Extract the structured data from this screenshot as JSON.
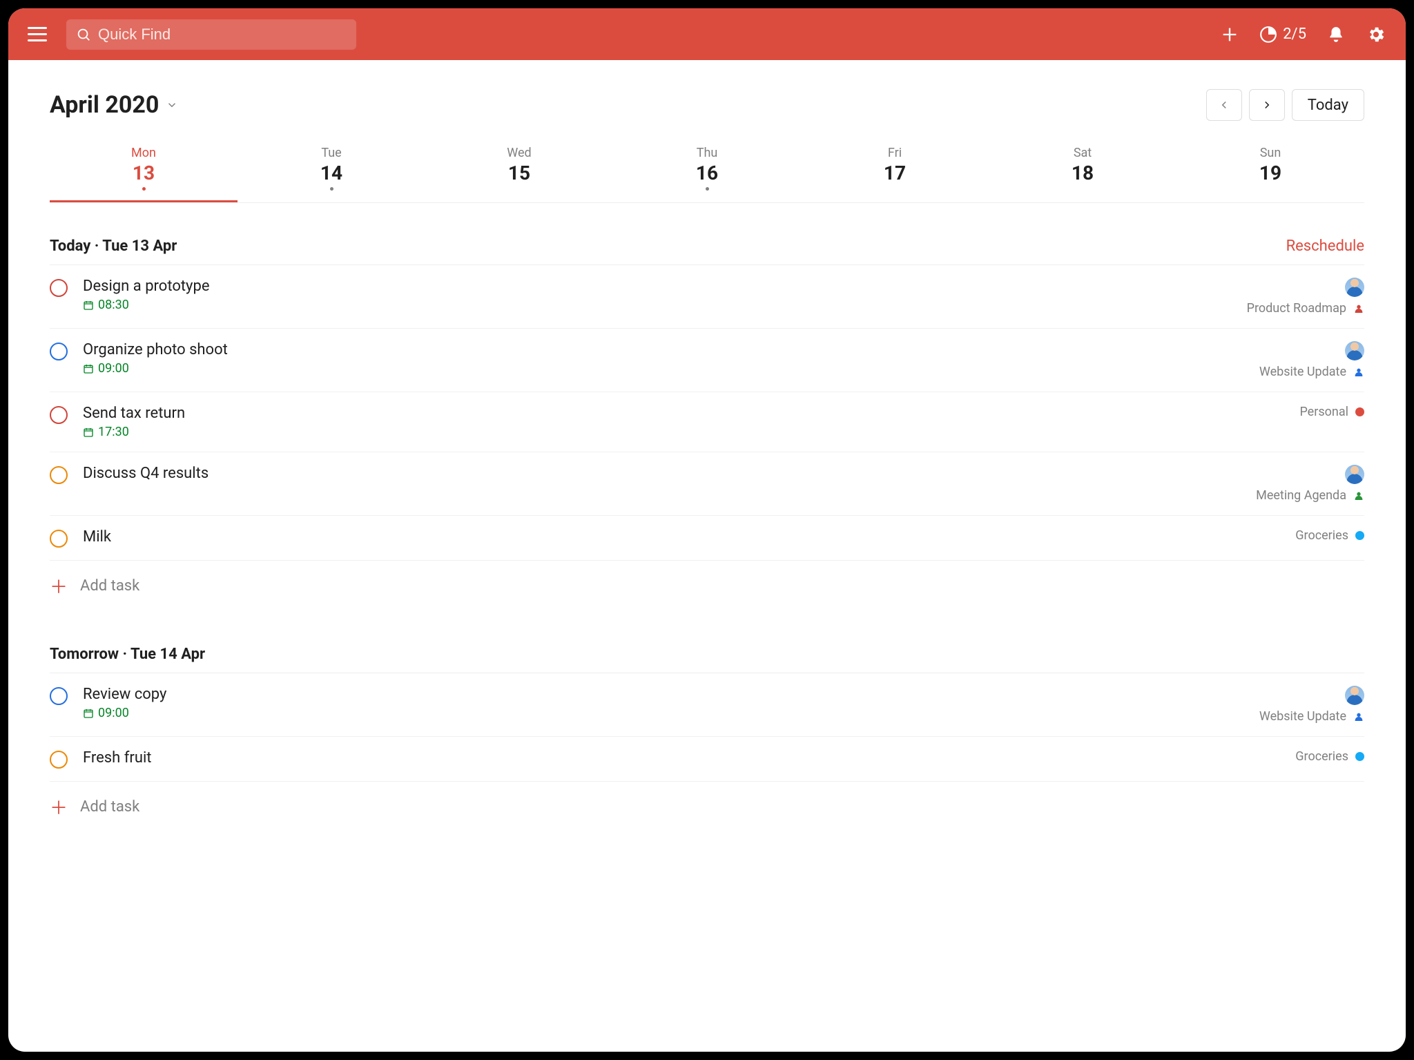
{
  "header": {
    "search_placeholder": "Quick Find",
    "productivity": "2/5"
  },
  "title": "April 2020",
  "today_label": "Today",
  "week": [
    {
      "name": "Mon",
      "num": "13",
      "active": true,
      "dot": true
    },
    {
      "name": "Tue",
      "num": "14",
      "active": false,
      "dot": true
    },
    {
      "name": "Wed",
      "num": "15",
      "active": false,
      "dot": false
    },
    {
      "name": "Thu",
      "num": "16",
      "active": false,
      "dot": true
    },
    {
      "name": "Fri",
      "num": "17",
      "active": false,
      "dot": false
    },
    {
      "name": "Sat",
      "num": "18",
      "active": false,
      "dot": false
    },
    {
      "name": "Sun",
      "num": "19",
      "active": false,
      "dot": false
    }
  ],
  "sections": [
    {
      "title": "Today · Tue 13 Apr",
      "reschedule": "Reschedule",
      "tasks": [
        {
          "title": "Design a prototype",
          "time": "08:30",
          "priority": "p1",
          "project": "Product Roadmap",
          "ptype": "person",
          "pcolor": "#d1453b",
          "avatar": true
        },
        {
          "title": "Organize photo shoot",
          "time": "09:00",
          "priority": "p2",
          "project": "Website Update",
          "ptype": "person",
          "pcolor": "#246fe0",
          "avatar": true
        },
        {
          "title": "Send tax return",
          "time": "17:30",
          "priority": "p1",
          "project": "Personal",
          "ptype": "dot",
          "pcolor": "#db4c3f",
          "avatar": false
        },
        {
          "title": "Discuss Q4 results",
          "time": "",
          "priority": "p3",
          "project": "Meeting Agenda",
          "ptype": "person",
          "pcolor": "#299438",
          "avatar": true
        },
        {
          "title": "Milk",
          "time": "",
          "priority": "p3",
          "project": "Groceries",
          "ptype": "dot",
          "pcolor": "#14aaf5",
          "avatar": false
        }
      ],
      "add": "Add task"
    },
    {
      "title": "Tomorrow · Tue 14 Apr",
      "reschedule": "",
      "tasks": [
        {
          "title": "Review copy",
          "time": "09:00",
          "priority": "p2",
          "project": "Website Update",
          "ptype": "person",
          "pcolor": "#246fe0",
          "avatar": true
        },
        {
          "title": "Fresh fruit",
          "time": "",
          "priority": "p3",
          "project": "Groceries",
          "ptype": "dot",
          "pcolor": "#14aaf5",
          "avatar": false
        }
      ],
      "add": "Add task"
    }
  ]
}
